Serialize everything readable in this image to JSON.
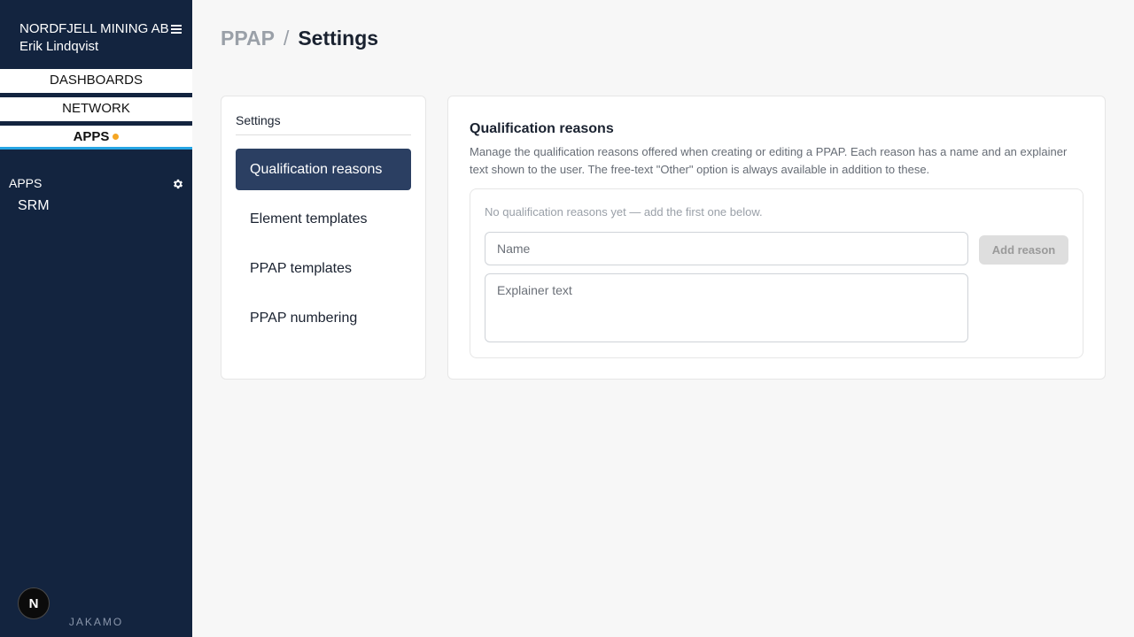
{
  "sidebar": {
    "org_name": "NORDFJELL MINING AB",
    "user_name": "Erik Lindqvist",
    "tabs": [
      {
        "label": "DASHBOARDS"
      },
      {
        "label": "NETWORK"
      },
      {
        "label": "APPS",
        "has_indicator": true
      }
    ],
    "apps_header": "APPS",
    "apps": [
      {
        "label": "SRM"
      }
    ],
    "avatar_letter": "N",
    "brand": "JAKAMO"
  },
  "breadcrumb": {
    "parent": "PPAP",
    "separator": "/",
    "current": "Settings"
  },
  "settings_nav": {
    "title": "Settings",
    "items": [
      {
        "label": "Qualification reasons",
        "active": true
      },
      {
        "label": "Element templates",
        "active": false
      },
      {
        "label": "PPAP templates",
        "active": false
      },
      {
        "label": "PPAP numbering",
        "active": false
      }
    ]
  },
  "content": {
    "title": "Qualification reasons",
    "description": "Manage the qualification reasons offered when creating or editing a PPAP. Each reason has a name and an explainer text shown to the user. The free-text \"Other\" option is always available in addition to these.",
    "empty_note": "No qualification reasons yet — add the first one below.",
    "name_placeholder": "Name",
    "explainer_placeholder": "Explainer text",
    "add_button": "Add reason"
  },
  "colors": {
    "sidebar_bg": "#13243f",
    "active_item_bg": "#2b3f62",
    "tab_underline": "#26a5e4",
    "indicator_dot": "#f5a623"
  }
}
